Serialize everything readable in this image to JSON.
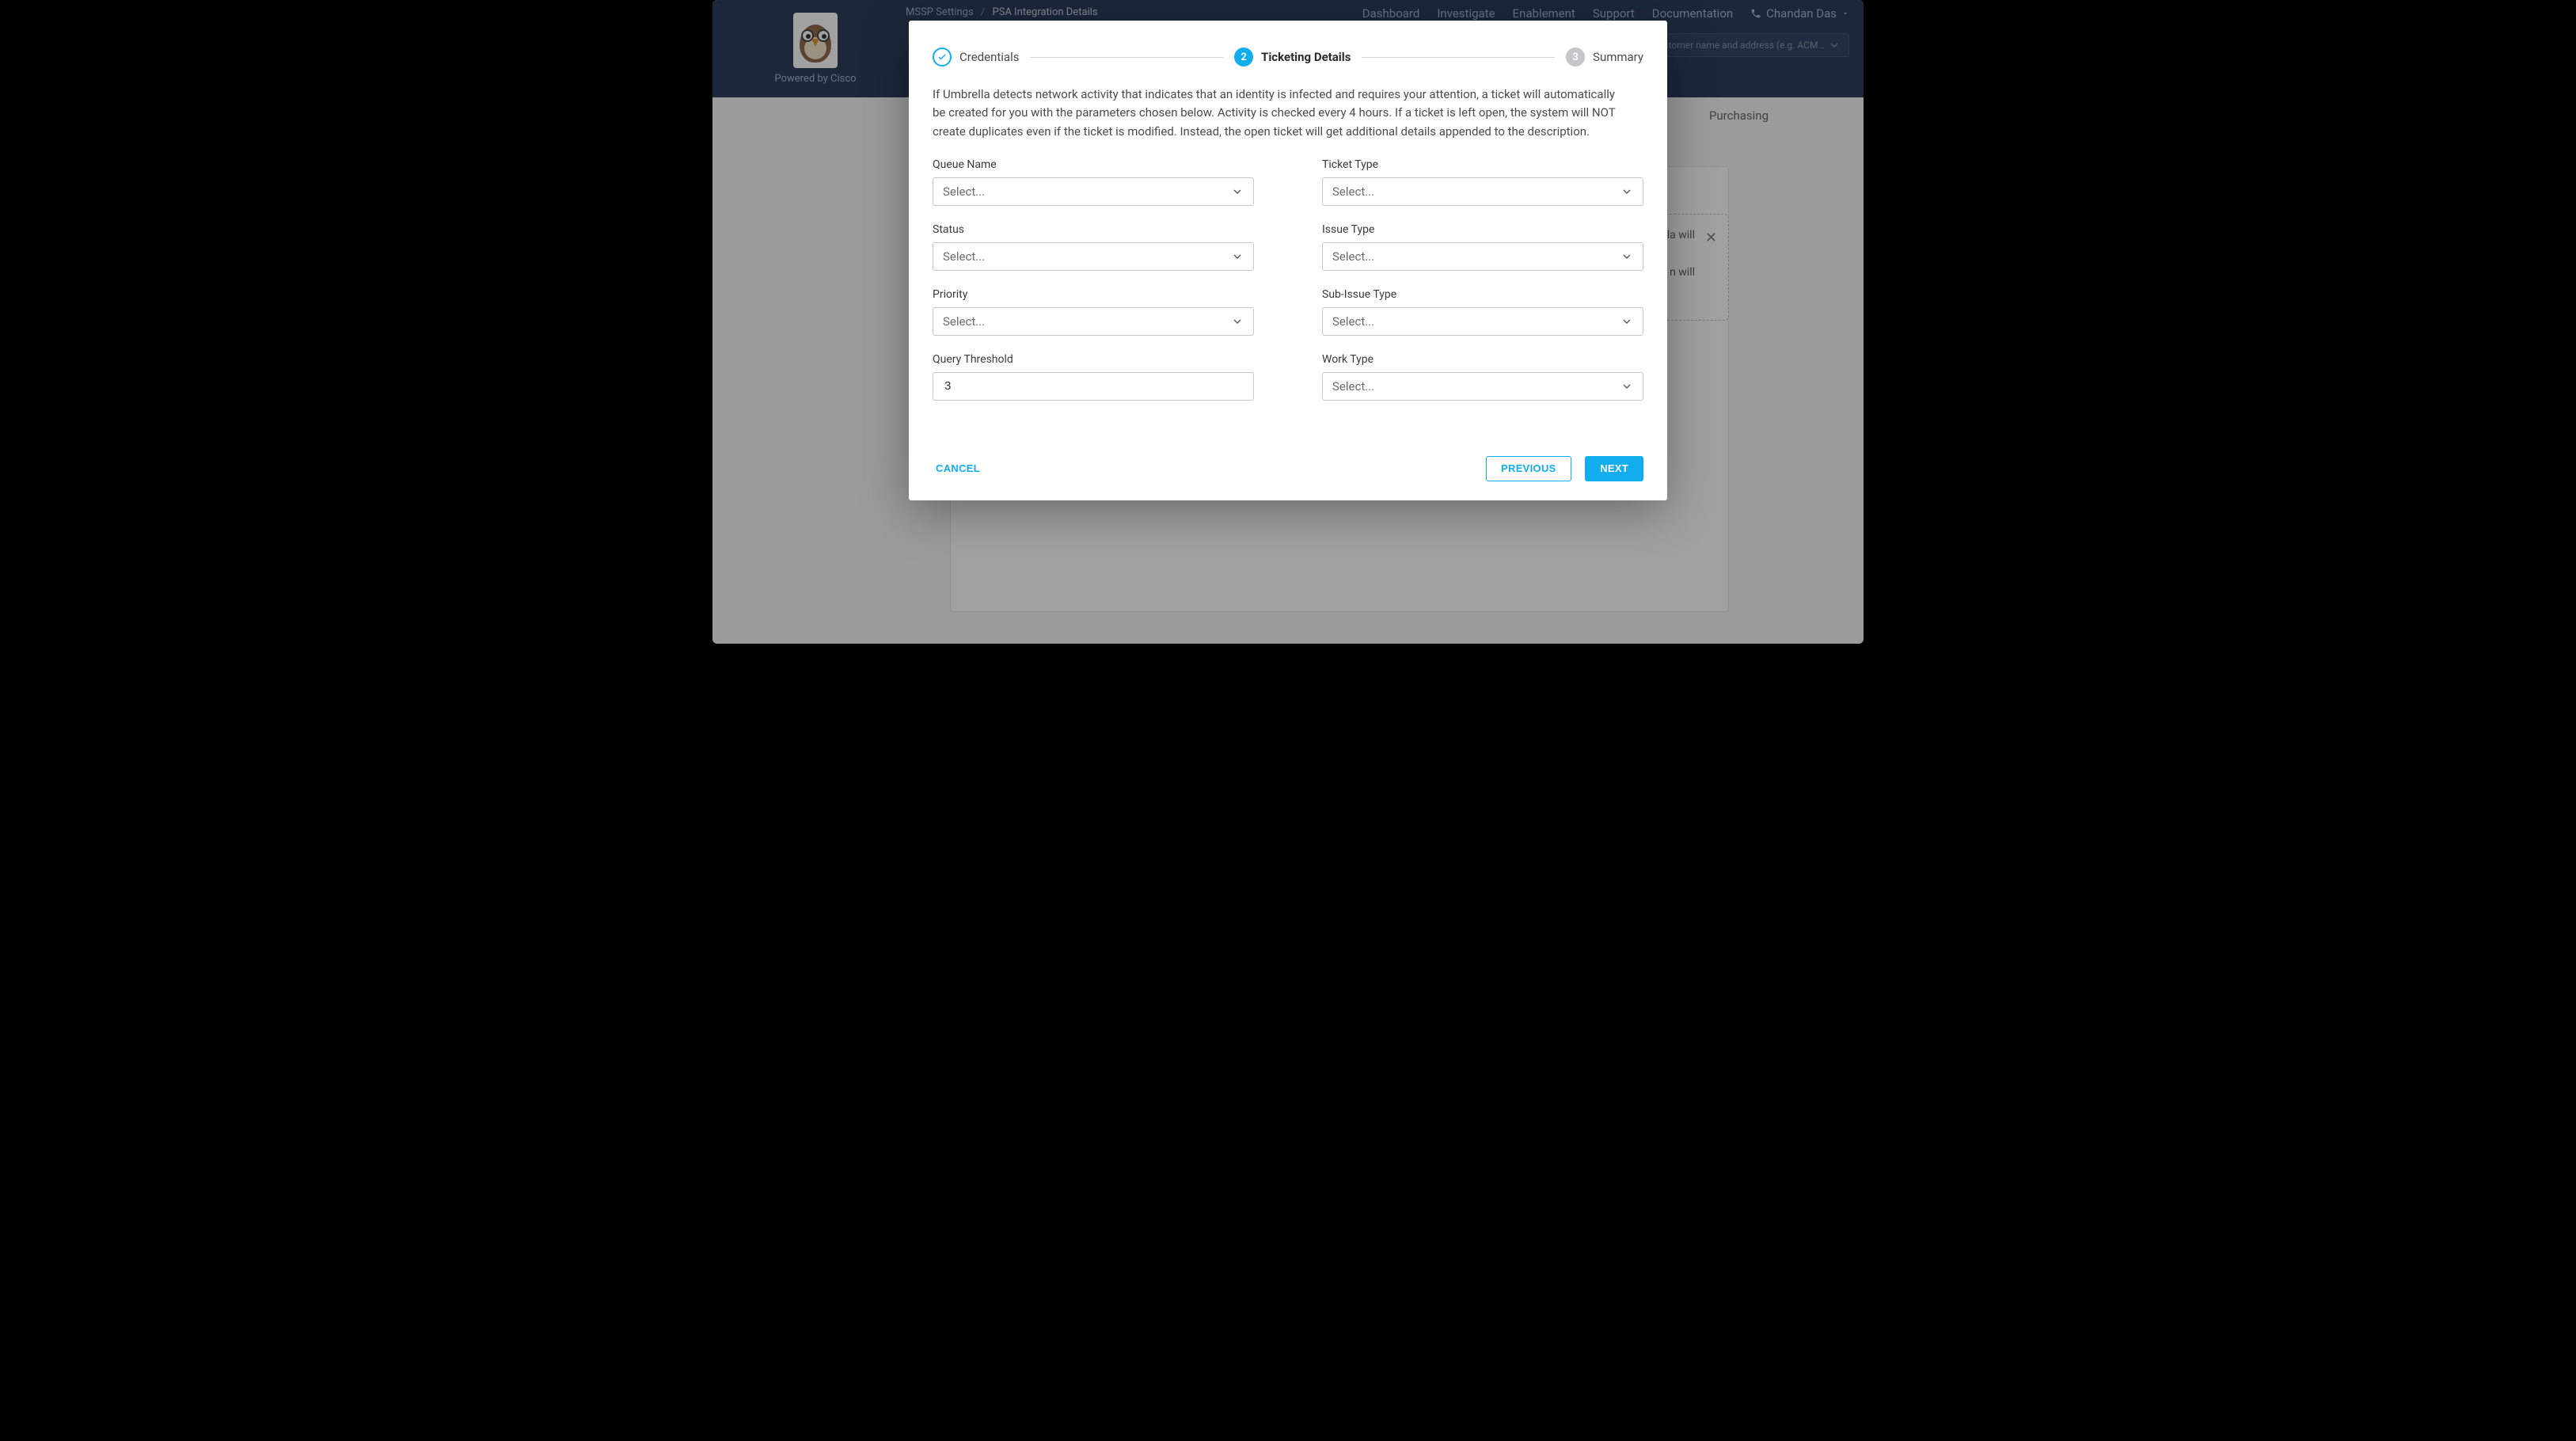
{
  "header": {
    "powered_by": "Powered by Cisco",
    "breadcrumb": {
      "root": "MSSP Settings",
      "current": "PSA Integration Details"
    },
    "nav": {
      "dashboard": "Dashboard",
      "investigate": "Investigate",
      "enablement": "Enablement",
      "support": "Support",
      "documentation": "Documentation",
      "user": "Chandan Das"
    },
    "customer_select_placeholder": "Customer name and address (e.g. ACME, New York)"
  },
  "tabs": {
    "purchasing": "Purchasing"
  },
  "alert": {
    "line1": "lla will",
    "line2": "n will"
  },
  "stepper": {
    "step1": "Credentials",
    "step2_num": "2",
    "step2": "Ticketing Details",
    "step3_num": "3",
    "step3": "Summary"
  },
  "description": "If Umbrella detects network activity that indicates that an identity is infected and requires your attention, a ticket will automatically be created for you with the parameters chosen below. Activity is checked every 4 hours. If a ticket is left open, the system will NOT create duplicates even if the ticket is modified. Instead, the open ticket will get additional details appended to the description.",
  "fields": {
    "queue_name": {
      "label": "Queue Name",
      "placeholder": "Select..."
    },
    "ticket_type": {
      "label": "Ticket Type",
      "placeholder": "Select..."
    },
    "status": {
      "label": "Status",
      "placeholder": "Select..."
    },
    "issue_type": {
      "label": "Issue Type",
      "placeholder": "Select..."
    },
    "priority": {
      "label": "Priority",
      "placeholder": "Select..."
    },
    "sub_issue": {
      "label": "Sub-Issue Type",
      "placeholder": "Select..."
    },
    "query_thresh": {
      "label": "Query Threshold",
      "value": "3"
    },
    "work_type": {
      "label": "Work Type",
      "placeholder": "Select..."
    }
  },
  "actions": {
    "cancel": "CANCEL",
    "previous": "PREVIOUS",
    "next": "NEXT"
  }
}
